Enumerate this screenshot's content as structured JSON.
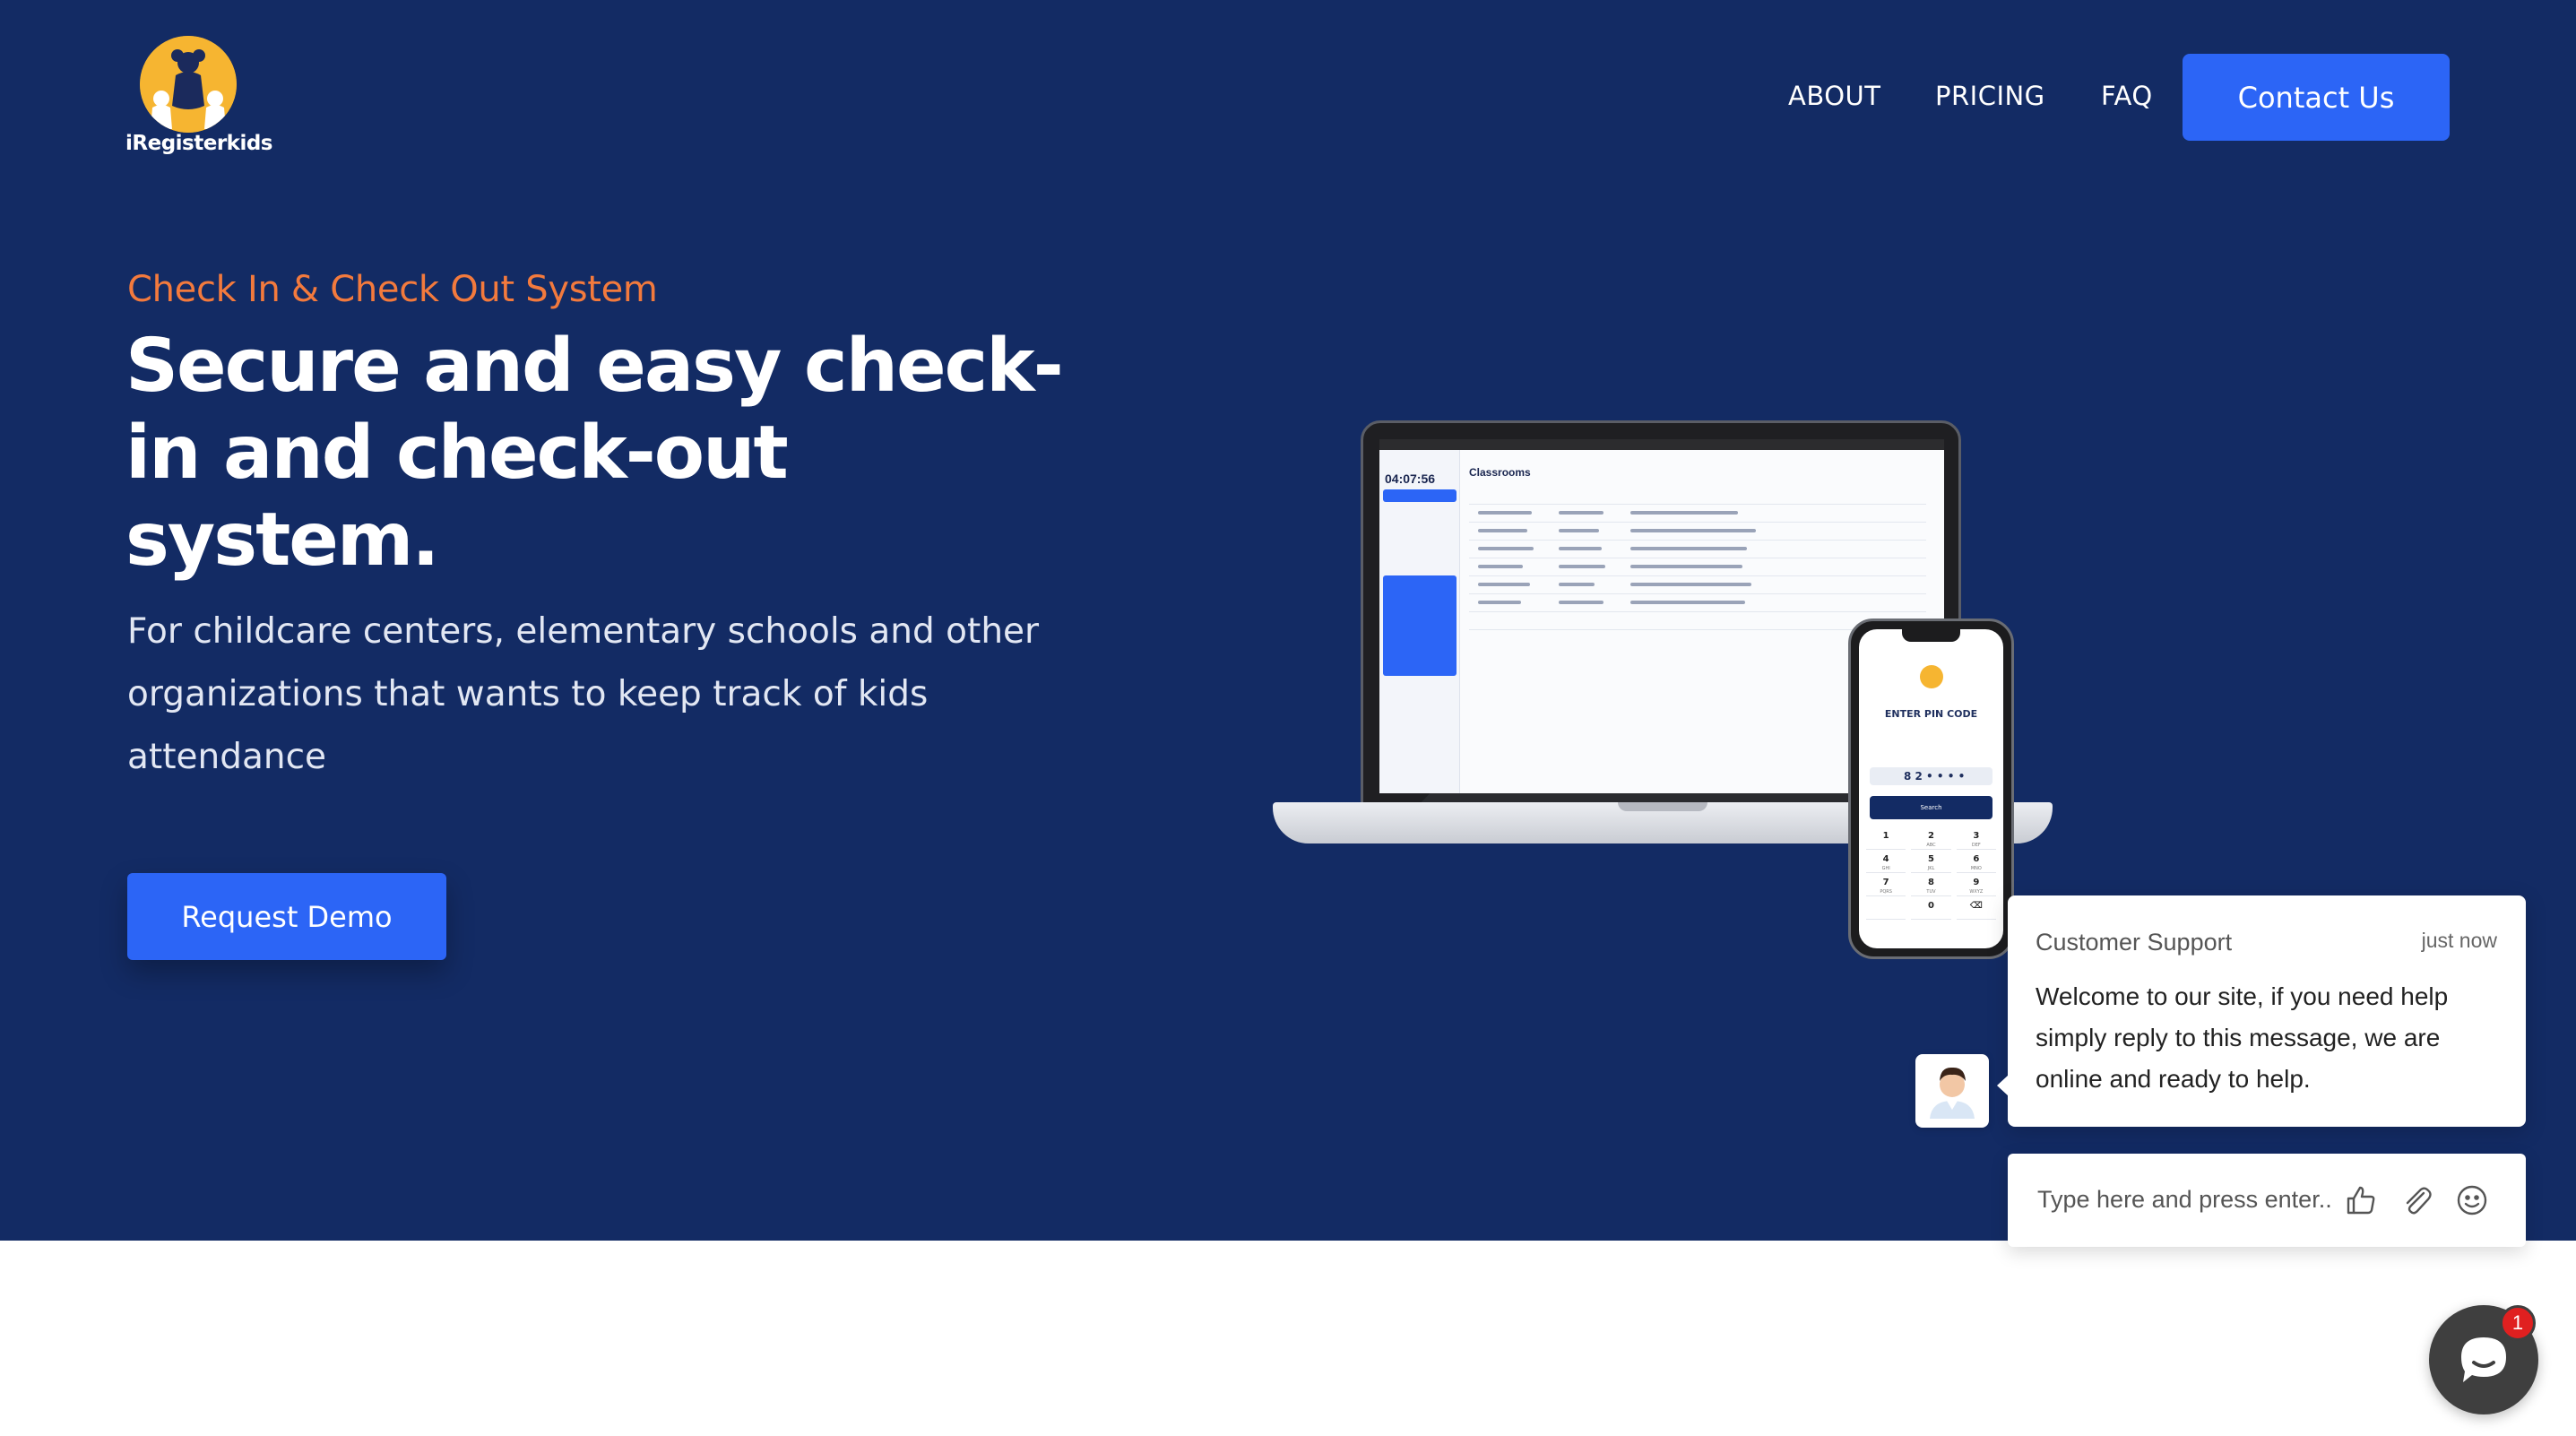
{
  "brand": {
    "name": "iRegisterkids"
  },
  "nav": {
    "links": [
      "ABOUT",
      "PRICING",
      "FAQ"
    ],
    "contact_label": "Contact Us"
  },
  "hero": {
    "eyebrow": "Check In & Check Out System",
    "headline": "Secure and easy check-in and check-out system.",
    "subtext": "For childcare centers, elementary schools and other organizations that wants to keep track of kids attendance",
    "cta_label": "Request Demo"
  },
  "mockup": {
    "laptop_clock": "04:07:56",
    "laptop_title": "Classrooms",
    "phone_label": "ENTER PIN CODE",
    "phone_pin": "8 2 • • • •",
    "phone_search": "Search",
    "keypad": [
      {
        "d": "1",
        "l": ""
      },
      {
        "d": "2",
        "l": "ABC"
      },
      {
        "d": "3",
        "l": "DEF"
      },
      {
        "d": "4",
        "l": "GHI"
      },
      {
        "d": "5",
        "l": "JKL"
      },
      {
        "d": "6",
        "l": "MNO"
      },
      {
        "d": "7",
        "l": "PQRS"
      },
      {
        "d": "8",
        "l": "TUV"
      },
      {
        "d": "9",
        "l": "WXYZ"
      },
      {
        "d": "",
        "l": ""
      },
      {
        "d": "0",
        "l": ""
      },
      {
        "d": "⌫",
        "l": ""
      }
    ]
  },
  "chat": {
    "sender": "Customer Support",
    "time": "just now",
    "message": "Welcome to our site, if you need help simply reply to this message, we are online and ready to help.",
    "input_placeholder": "Type here and press enter..",
    "unread_count": "1"
  },
  "colors": {
    "hero_bg": "#132b64",
    "accent_blue": "#2c65f6",
    "eyebrow_orange": "#f37a3d",
    "badge_red": "#e02020"
  },
  "icons": [
    "logo-mascot-icon",
    "thumbs-up-icon",
    "paperclip-icon",
    "smiley-icon",
    "chat-bubble-icon",
    "agent-avatar-icon"
  ]
}
